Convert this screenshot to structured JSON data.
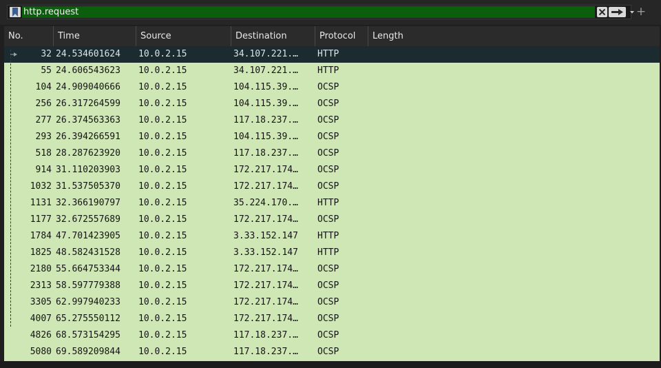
{
  "filter": {
    "value": "http.request"
  },
  "add_label": "+",
  "columns": [
    "No.",
    "Time",
    "Source",
    "Destination",
    "Protocol",
    "Length"
  ],
  "rows": [
    {
      "no": "32",
      "time": "24.534601624",
      "src": "10.0.2.15",
      "dst": "34.107.221.…",
      "proto": "HTTP",
      "selected": true
    },
    {
      "no": "55",
      "time": "24.606543623",
      "src": "10.0.2.15",
      "dst": "34.107.221.…",
      "proto": "HTTP"
    },
    {
      "no": "104",
      "time": "24.909040666",
      "src": "10.0.2.15",
      "dst": "104.115.39.…",
      "proto": "OCSP"
    },
    {
      "no": "256",
      "time": "26.317264599",
      "src": "10.0.2.15",
      "dst": "104.115.39.…",
      "proto": "OCSP"
    },
    {
      "no": "277",
      "time": "26.374563363",
      "src": "10.0.2.15",
      "dst": "117.18.237.…",
      "proto": "OCSP"
    },
    {
      "no": "293",
      "time": "26.394266591",
      "src": "10.0.2.15",
      "dst": "104.115.39.…",
      "proto": "OCSP"
    },
    {
      "no": "518",
      "time": "28.287623920",
      "src": "10.0.2.15",
      "dst": "117.18.237.…",
      "proto": "OCSP"
    },
    {
      "no": "914",
      "time": "31.110203903",
      "src": "10.0.2.15",
      "dst": "172.217.174…",
      "proto": "OCSP"
    },
    {
      "no": "1032",
      "time": "31.537505370",
      "src": "10.0.2.15",
      "dst": "172.217.174…",
      "proto": "OCSP"
    },
    {
      "no": "1131",
      "time": "32.366190797",
      "src": "10.0.2.15",
      "dst": "35.224.170.…",
      "proto": "HTTP"
    },
    {
      "no": "1177",
      "time": "32.672557689",
      "src": "10.0.2.15",
      "dst": "172.217.174…",
      "proto": "OCSP"
    },
    {
      "no": "1784",
      "time": "47.701423905",
      "src": "10.0.2.15",
      "dst": "3.33.152.147",
      "proto": "HTTP"
    },
    {
      "no": "1825",
      "time": "48.582431528",
      "src": "10.0.2.15",
      "dst": "3.33.152.147",
      "proto": "HTTP"
    },
    {
      "no": "2180",
      "time": "55.664753344",
      "src": "10.0.2.15",
      "dst": "172.217.174…",
      "proto": "OCSP"
    },
    {
      "no": "2313",
      "time": "58.597779388",
      "src": "10.0.2.15",
      "dst": "172.217.174…",
      "proto": "OCSP"
    },
    {
      "no": "3305",
      "time": "62.997940233",
      "src": "10.0.2.15",
      "dst": "172.217.174…",
      "proto": "OCSP"
    },
    {
      "no": "4007",
      "time": "65.275550112",
      "src": "10.0.2.15",
      "dst": "172.217.174…",
      "proto": "OCSP"
    },
    {
      "no": "4826",
      "time": "68.573154295",
      "src": "10.0.2.15",
      "dst": "117.18.237.…",
      "proto": "OCSP"
    },
    {
      "no": "5080",
      "time": "69.589209844",
      "src": "10.0.2.15",
      "dst": "117.18.237.…",
      "proto": "OCSP"
    }
  ],
  "colors": {
    "filter_valid": "#0b5e0b",
    "row_bg": "#cfe6b5",
    "selected_bg": "#1c2b30"
  },
  "icons": {
    "bookmark": "bookmark-icon",
    "clear": "clear-icon",
    "apply": "apply-arrow-icon",
    "dropdown": "chevron-down-icon",
    "add": "plus-icon"
  }
}
